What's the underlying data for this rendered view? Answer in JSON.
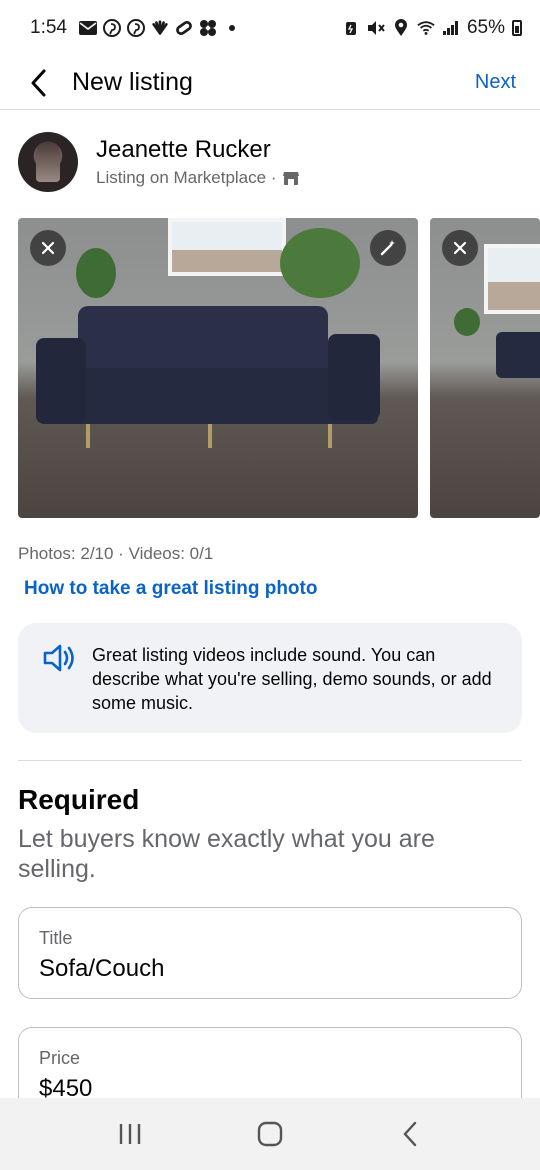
{
  "status_bar": {
    "time": "1:54",
    "battery": "65%"
  },
  "header": {
    "title": "New listing",
    "next_label": "Next"
  },
  "seller": {
    "name": "Jeanette Rucker",
    "subtitle": "Listing on Marketplace ·"
  },
  "photos": {
    "counts": "Photos: 2/10 · Videos: 0/1",
    "help_link": "How to take a great listing photo"
  },
  "tip": {
    "text": "Great listing videos include sound. You can describe what you're selling, demo sounds, or add some music."
  },
  "required": {
    "heading": "Required",
    "subheading": "Let buyers know exactly what you are selling.",
    "title_label": "Title",
    "title_value": "Sofa/Couch",
    "price_label": "Price",
    "price_value": "$450"
  },
  "colors": {
    "accent": "#0a63c9",
    "secondary_text": "#65676b",
    "card_bg": "#f0f2f5"
  }
}
